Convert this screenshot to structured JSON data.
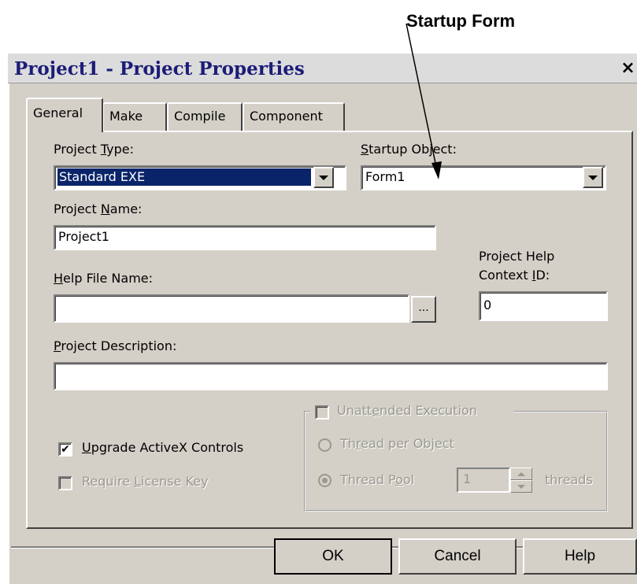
{
  "annotation": {
    "label": "Startup Form"
  },
  "window": {
    "title": "Project1 - Project Properties",
    "close_glyph": "×"
  },
  "tabs": [
    {
      "label": "General",
      "active": true
    },
    {
      "label": "Make",
      "active": false
    },
    {
      "label": "Compile",
      "active": false
    },
    {
      "label": "Component",
      "active": false
    }
  ],
  "general": {
    "project_type": {
      "label_pre": "Project ",
      "label_key": "T",
      "label_post": "ype:",
      "value": "Standard EXE"
    },
    "startup_object": {
      "label_pre": "",
      "label_key": "S",
      "label_post": "tartup Object:",
      "value": "Form1"
    },
    "project_name": {
      "label_pre": "Project ",
      "label_key": "N",
      "label_post": "ame:",
      "value": "Project1"
    },
    "help_file": {
      "label_pre": "",
      "label_key": "H",
      "label_post": "elp File Name:",
      "value": "",
      "browse": "..."
    },
    "help_context": {
      "label_line1": "Project Help",
      "label_line2_pre": "Context ",
      "label_line2_key": "I",
      "label_line2_post": "D:",
      "value": "0"
    },
    "description": {
      "label_pre": "",
      "label_key": "P",
      "label_post": "roject Description:",
      "value": ""
    },
    "upgrade_activex": {
      "label_pre": "",
      "label_key": "U",
      "label_post": "pgrade ActiveX Controls",
      "checked": true,
      "check_glyph": "✔"
    },
    "require_license": {
      "label_pre": "Require ",
      "label_key": "L",
      "label_post": "icense Key",
      "checked": false
    },
    "unattended": {
      "label_pre": "Unatt",
      "label_key": "e",
      "label_post": "nded Execution",
      "checked": false
    },
    "thread_per_object": {
      "label_pre": "Th",
      "label_key": "r",
      "label_post": "ead per Object"
    },
    "thread_pool": {
      "label_pre": "Thread P",
      "label_key": "o",
      "label_post": "ol",
      "value": "1",
      "unit": "threads"
    }
  },
  "buttons": {
    "ok": "OK",
    "cancel": "Cancel",
    "help": "Help"
  },
  "colors": {
    "dialog_bg": "#d4d0c8",
    "selection": "#0a246a",
    "title_text": "#1c1c78",
    "disabled_text": "#9a9890"
  }
}
